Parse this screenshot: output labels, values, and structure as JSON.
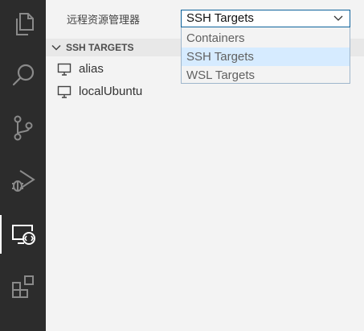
{
  "activity_bar": {
    "items": [
      {
        "icon": "files-icon"
      },
      {
        "icon": "search-icon"
      },
      {
        "icon": "source-control-icon"
      },
      {
        "icon": "run-debug-icon"
      },
      {
        "icon": "remote-explorer-icon",
        "active": true
      },
      {
        "icon": "extensions-icon"
      }
    ]
  },
  "sidebar": {
    "title": "远程资源管理器",
    "remote_select": {
      "value": "SSH Targets",
      "options": [
        "Containers",
        "SSH Targets",
        "WSL Targets"
      ],
      "selected_index": 1
    },
    "section": {
      "title": "SSH TARGETS"
    },
    "targets": [
      {
        "label": "alias",
        "icon": "monitor-icon"
      },
      {
        "label": "localUbuntu",
        "icon": "monitor-icon"
      }
    ]
  },
  "colors": {
    "activity_bar_bg": "#2c2c2c",
    "sidebar_bg": "#f3f3f3",
    "focus_border": "#0e639c",
    "selected_option_bg": "#d6ebff"
  }
}
